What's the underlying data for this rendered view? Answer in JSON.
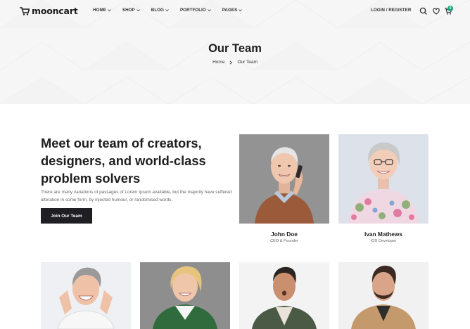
{
  "header": {
    "logo_text": "mooncart",
    "menu": [
      {
        "label": "HOME"
      },
      {
        "label": "SHOP"
      },
      {
        "label": "BLOG"
      },
      {
        "label": "PORTFOLIO"
      },
      {
        "label": "PAGES"
      }
    ],
    "auth_label": "LOGIN / REGISTER",
    "cart_count": "0",
    "icons": [
      "search-icon",
      "wishlist-heart-icon",
      "cart-icon"
    ]
  },
  "hero": {
    "title": "Our Team",
    "breadcrumb": {
      "home": "Home",
      "current": "Our Team"
    }
  },
  "intro": {
    "heading": "Meet our team of creators, designers, and world-class problem solvers",
    "body": "There are many variations of passages of Lorem Ipsum available, but the majority have suffered alteration in some form, by injected humour, or randomised words.",
    "cta_label": "Join Our Team"
  },
  "team": [
    {
      "name": "John Doe",
      "role": "CEO & Founder"
    },
    {
      "name": "Ivan Mathews",
      "role": "IOS Developer"
    }
  ],
  "colors": {
    "accent": "#1f1f23",
    "badge": "#1aa37a",
    "hero_bg": "#f6f6f6"
  }
}
